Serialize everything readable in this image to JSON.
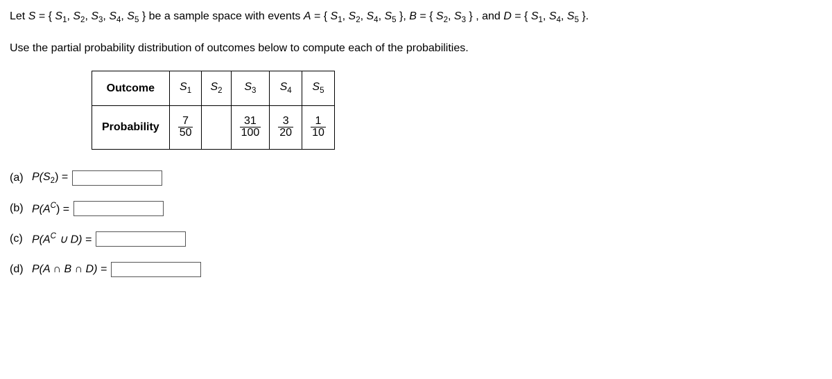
{
  "prompt": {
    "prefix": "Let ",
    "Sdef_pre": " = {",
    "set_items": [
      "S",
      "S",
      "S",
      "S",
      "S"
    ],
    "Sdef_mid": "} be a sample space with events ",
    "A_label": "A",
    "A_items": [
      "S",
      "S",
      "S",
      "S"
    ],
    "B_label": "B",
    "B_items": [
      "S",
      "S"
    ],
    "D_label": "D",
    "D_items": [
      "S",
      "S",
      "S"
    ],
    "S_subs": [
      "1",
      "2",
      "3",
      "4",
      "5"
    ],
    "A_subs": [
      "1",
      "2",
      "4",
      "5"
    ],
    "B_subs": [
      "2",
      "3"
    ],
    "D_subs": [
      "1",
      "4",
      "5"
    ],
    "eq": " = ",
    "lbrace": "{",
    "rbrace": "}",
    "comma": ", ",
    "and": ", and ",
    "period": ".",
    "line2": "Use the partial probability distribution of outcomes below to compute each of the probabilities."
  },
  "table": {
    "row1_label": "Outcome",
    "col_letter": "S",
    "col_subs": [
      "1",
      "2",
      "3",
      "4",
      "5"
    ],
    "row2_label": "Probability",
    "probs": [
      {
        "num": "7",
        "den": "50"
      },
      null,
      {
        "num": "31",
        "den": "100"
      },
      {
        "num": "3",
        "den": "20"
      },
      {
        "num": "1",
        "den": "10"
      }
    ]
  },
  "questions": {
    "a_label": "(a)",
    "a_expr_pre": "P(",
    "a_S": "S",
    "a_sub": "2",
    "a_close": ") = ",
    "b_label": "(b)",
    "b_expr": "P(A",
    "b_sup": "C",
    "b_close": ") = ",
    "c_label": "(c)",
    "c_expr": "P(A",
    "c_sup": "C",
    "c_mid": " ∪ D) = ",
    "d_label": "(d)",
    "d_expr": "P(A ∩ B ∩ D) = "
  }
}
